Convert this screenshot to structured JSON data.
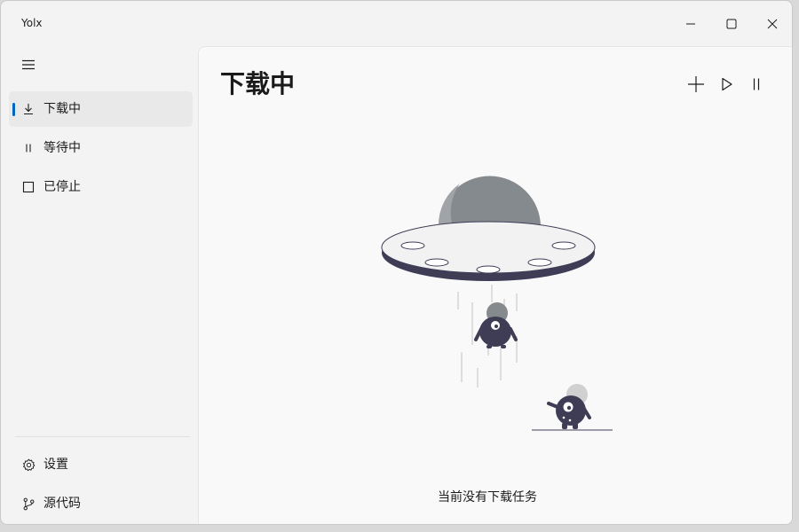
{
  "window": {
    "title": "Yolx"
  },
  "titlebar": {
    "icons": {
      "minimize": "minimize-icon",
      "maximize": "maximize-icon",
      "close": "close-icon"
    }
  },
  "sidebar": {
    "menu_icon": "hamburger-icon",
    "items": [
      {
        "label": "下载中",
        "icon": "download-icon",
        "selected": true
      },
      {
        "label": "等待中",
        "icon": "pause-icon",
        "selected": false
      },
      {
        "label": "已停止",
        "icon": "stop-icon",
        "selected": false
      }
    ],
    "footer": [
      {
        "label": "设置",
        "icon": "gear-icon"
      },
      {
        "label": "源代码",
        "icon": "branch-icon"
      }
    ]
  },
  "main": {
    "title": "下载中",
    "toolbar": {
      "add_icon": "plus-icon",
      "start_icon": "play-icon",
      "pause_icon": "pause-icon"
    },
    "empty_state": {
      "message": "当前没有下载任务",
      "illustration": "ufo-illustration"
    }
  },
  "colors": {
    "accent": "#0067c0",
    "window_bg": "#f3f3f3",
    "content_bg": "#f9f9f9",
    "ufo_dome": "#858a8f",
    "ufo_rim": "#3f3d56"
  }
}
